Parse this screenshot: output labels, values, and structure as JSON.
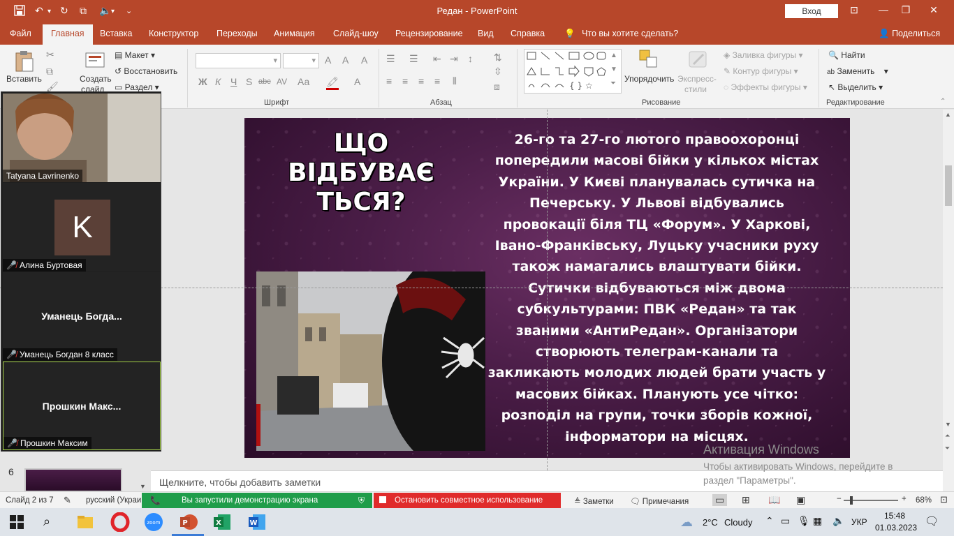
{
  "window": {
    "title": "Редан  -  PowerPoint",
    "signin_label": "Вход",
    "min": "—",
    "restore": "❐",
    "close": "✕"
  },
  "ribbon_tabs": [
    "Файл",
    "Главная",
    "Вставка",
    "Конструктор",
    "Переходы",
    "Анимация",
    "Слайд-шоу",
    "Рецензирование",
    "Вид",
    "Справка"
  ],
  "active_tab": "Главная",
  "tell_me": "Что вы хотите сделать?",
  "share": "Поделиться",
  "ribbon": {
    "paste": "Вставить",
    "new_slide_line1": "Создать",
    "new_slide_line2": "слайд",
    "layout": "Макет",
    "reset": "Восстановить",
    "section": "Раздел",
    "font_group": "Шрифт",
    "paragraph_group": "Абзац",
    "drawing_group": "Рисование",
    "editing_group": "Редактирование",
    "font_buttons": [
      "Ж",
      "К",
      "Ч",
      "S",
      "abc",
      "AV",
      "Аа",
      "A"
    ],
    "arrange": "Упорядочить",
    "quick_styles_line1": "Экспресс-",
    "quick_styles_line2": "стили",
    "shape_fill": "Заливка фигуры",
    "shape_outline": "Контур фигуры",
    "shape_effects": "Эффекты фигуры",
    "find": "Найти",
    "replace": "Заменить",
    "select": "Выделить"
  },
  "slide": {
    "title": "ЩО ВІДБУВАЄ ТЬСЯ?",
    "body": "26-го та 27-го лютого правоохоронці попередили масові бійки у кількох містах України. У Києві планувалась сутичка на Печерську. У Львові відбувались провокації біля ТЦ «Форум». У Харкові, Івано-Франківську, Луцьку учасники руху також намагались влаштувати бійки. Сутички відбуваються між двома субкультурами: ПВК «Редан» та так званими «АнтиРедан». Організатори створюють телеграм-канали та закликають молодих людей брати участь у масових бійках. Планують усе чітко: розподіл на групи, точки зборів кожної, інформатори на місцях."
  },
  "participants": [
    {
      "name": "Tatyana Lavrinenko",
      "muted": false,
      "type": "video"
    },
    {
      "name": "Алина Буртовая",
      "muted": true,
      "type": "avatar",
      "initial": "K"
    },
    {
      "name": "Уманець Богдан 8 класс",
      "display": "Уманець  Богда...",
      "muted": true,
      "type": "name"
    },
    {
      "name": "Прошкин Максим",
      "display": "Прошкин  Макс...",
      "muted": true,
      "type": "name"
    }
  ],
  "thumb_number": "6",
  "notes_placeholder": "Щелкните, чтобы добавить заметки",
  "activation": {
    "title": "Активация Windows",
    "line1": "Чтобы активировать Windows, перейдите в",
    "line2": "раздел \"Параметры\"."
  },
  "status": {
    "slide_of": "Слайд 2 из 7",
    "language": "русский (Украи",
    "share_running": "Вы запустили демонстрацию экрана",
    "stop_sharing": "Остановить совместное использование",
    "notes": "Заметки",
    "comments": "Примечания",
    "zoom": "68%"
  },
  "taskbar": {
    "temperature": "2°C",
    "weather": "Cloudy",
    "lang": "УКР",
    "time": "15:48",
    "date": "01.03.2023"
  }
}
